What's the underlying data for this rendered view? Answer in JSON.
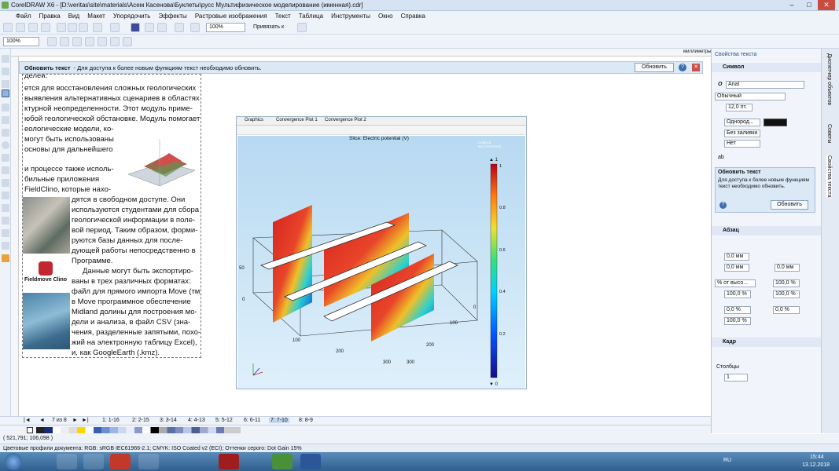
{
  "app": {
    "title": "CorelDRAW X6 - [D:\\veritas\\site\\materials\\Асем Касенова\\Буклеты\\русс Мультифизическое моделирование (именная).cdr]",
    "window_buttons": [
      "–",
      "□",
      "✕"
    ]
  },
  "menu": [
    "Файл",
    "Правка",
    "Вид",
    "Макет",
    "Упорядочить",
    "Эффекты",
    "Растровые изображения",
    "Текст",
    "Таблица",
    "Инструменты",
    "Окно",
    "Справка"
  ],
  "toolbar": {
    "zoom": "100%",
    "snap_label": "Привязать к"
  },
  "propbar": {
    "zoom": "100%"
  },
  "ruler": {
    "unit": "миллиметры"
  },
  "infobar": {
    "title": "Обновить текст",
    "message": "- Для доступа к более новым функциям текст необходимо обновить.",
    "button": "Обновить"
  },
  "document": {
    "lines": [
      "делей.",
      "ется для восстановления сложных геологических",
      "выявления альтернативных сценариев в областях",
      "ктурной неопределенности. Этот модуль приме-",
      "юбой геологической обстановке. Модуль помогает",
      "еологические модели, ко-",
      "могут быть использованы",
      "основы для дальнейшего",
      "и процессе также исполь-",
      "бильные приложения",
      "FieldClino, которые нахо-",
      "дятся в свободном доступе. Они",
      "используются студентами для сбора",
      "геологической информации в поле-",
      "вой период. Таким образом, форми-",
      "руются базы данных для после-",
      "дующей работы непосредственно в",
      "Программе.",
      "Данные могут быть экспортиро-",
      "ваны в трех различных форматах:",
      "файл для прямого импорта Move (тм),",
      "в Move программное обеспечение",
      "Midland долины для построения мо-",
      "дели и анализа, в файл CSV (зна-",
      "чения, разделенные запятыми, похо-",
      "жий на электронную таблицу Excel),",
      "и, как GoogleEarth (.kmz)."
    ],
    "logo_text": "Fieldmove Clino"
  },
  "figure": {
    "tabs": [
      "Graphics",
      "Convergence Plot 1",
      "Convergence Plot 2"
    ],
    "title": "Slice: Electric potential (V)",
    "watermark": "COMSOL MULTIPHYSICS",
    "colorbar_max": "▲ 1",
    "colorbar_min": "▼ 0",
    "colorbar_ticks": [
      "1",
      "0.8",
      "0.6",
      "0.4",
      "0.2",
      "0"
    ],
    "axis_labels": [
      "50",
      "0",
      "100",
      "200",
      "300",
      "0",
      "100",
      "200",
      "300"
    ]
  },
  "docknav": {
    "page_indicator": "7 из 8",
    "pages": [
      "1: 1-16",
      "2: 2-15",
      "3: 3-14",
      "4: 4-13",
      "5: 5-12",
      "6: 6-11",
      "7: 7-10",
      "8: 8-9"
    ]
  },
  "statusbar": {
    "coords": "( 521,791; 106,098 )",
    "profiles": "Цветовые профили документа: RGB: sRGB IEC61966-2.1; CMYK: ISO Coated v2 (ECI); Оттенки серого: Dot Gain 15%"
  },
  "dock": {
    "title": "Свойства текста",
    "symbol_header": "Символ",
    "font": "Arial",
    "style": "Обычный",
    "size": "12,0 пт.",
    "fill1": "Однород...",
    "fill2": "Без заливки",
    "outline": "Нет",
    "callout_title": "Обновить текст",
    "callout_body": "Для доступа к более новым функциям текст необходимо обновить.",
    "callout_button": "Обновить",
    "para_header": "Абзац",
    "para_vals": [
      "0,0 мм",
      "0,0 мм",
      "0,0 мм",
      "% от высо...",
      "100,0 %",
      "100,0 %",
      "100,0 %",
      "0,0 %",
      "0,0 %",
      "100,0 %"
    ],
    "frame_header": "Кадр",
    "columns_label": "Столбцы",
    "columns_value": "1"
  },
  "sidetabs": [
    "Диспетчер объектов",
    "Советы",
    "Свойства текста"
  ],
  "taskbar": {
    "lang": "RU",
    "time": "15:44",
    "date": "13.12.2018"
  },
  "colors": {
    "accent": "#2f5f8e",
    "selected_page": "#c5d9f1"
  }
}
